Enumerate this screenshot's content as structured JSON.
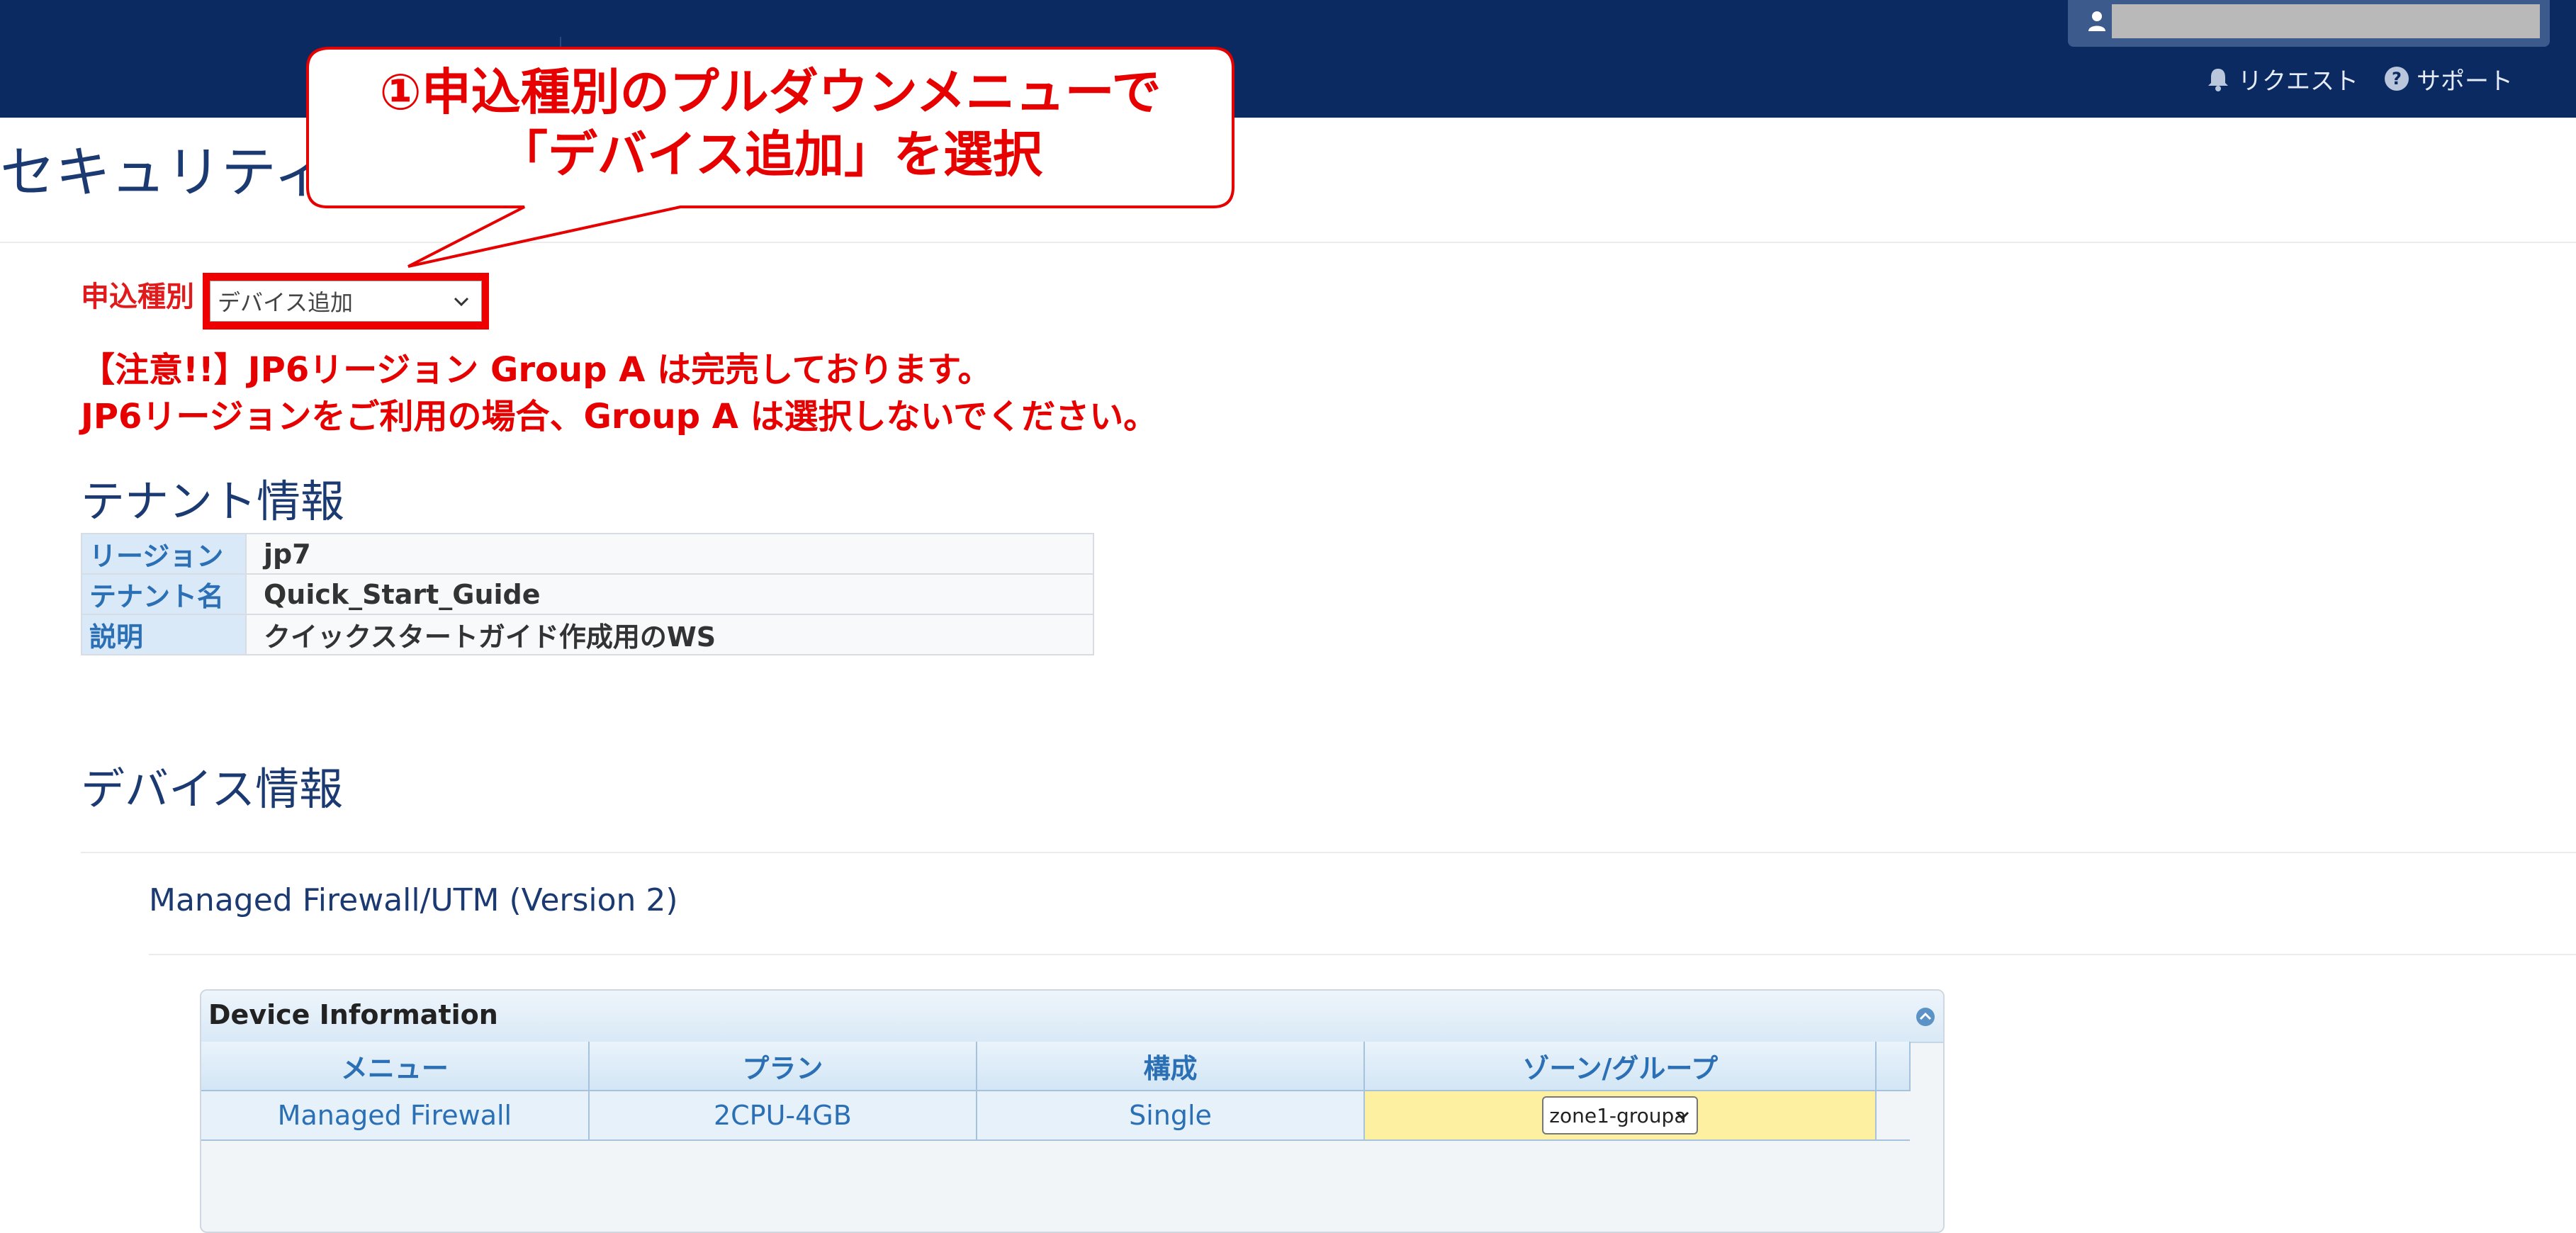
{
  "header": {
    "request_label": "リクエスト",
    "support_label": "サポート"
  },
  "page": {
    "title": "セキュリティ"
  },
  "callout": {
    "line1": "①申込種別のプルダウンメニューで",
    "line2": "「デバイス追加」を選択",
    "color": "#e60000"
  },
  "application": {
    "label": "申込種別",
    "selected": "デバイス追加"
  },
  "notice": {
    "line1": "【注意!!】JP6リージョン Group A は完売しております。",
    "line2": "JP6リージョンをご利用の場合、Group A は選択しないでください。"
  },
  "tenant": {
    "section_title": "テナント情報",
    "rows": [
      {
        "key": "リージョン",
        "value": "jp7"
      },
      {
        "key": "テナント名",
        "value": "Quick_Start_Guide"
      },
      {
        "key": "説明",
        "value": "クイックスタートガイド作成用のWS"
      }
    ]
  },
  "device": {
    "section_title": "デバイス情報",
    "product_title": "Managed Firewall/UTM (Version 2)",
    "panel_title": "Device Information",
    "columns": [
      "メニュー",
      "プラン",
      "構成",
      "ゾーン/グループ"
    ],
    "row": {
      "menu": "Managed Firewall",
      "plan": "2CPU-4GB",
      "config": "Single",
      "zone": "zone1-groupa"
    }
  },
  "colors": {
    "header_bg": "#0b2a62",
    "accent_red": "#e60000",
    "link_blue": "#2b6fb5",
    "zone_highlight": "#fdf0a0"
  }
}
